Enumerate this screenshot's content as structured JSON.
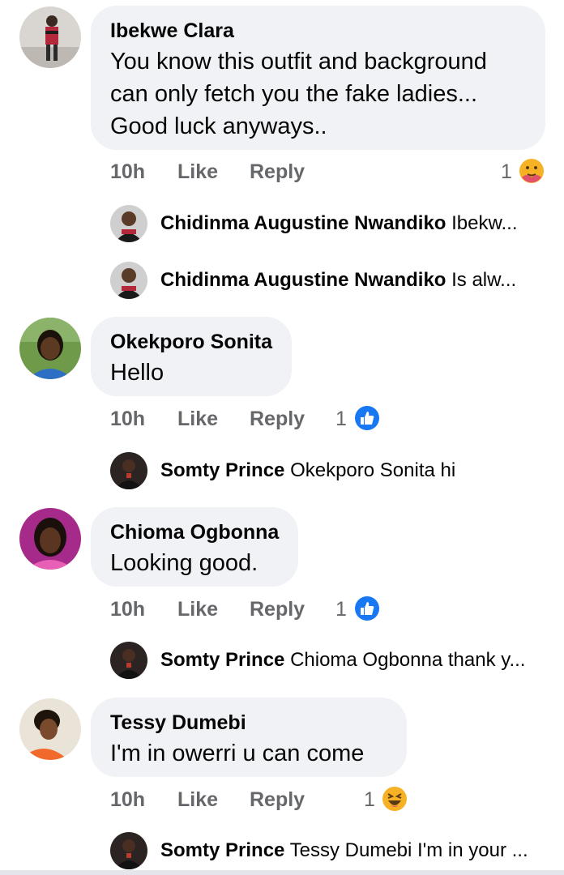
{
  "comments": [
    {
      "author": "Ibekwe Clara",
      "lines": [
        "You know this outfit and background",
        "can only fetch you the fake ladies...",
        "Good luck anyways.."
      ],
      "time": "10h",
      "like": "Like",
      "reply": "Reply",
      "reaction_count": "1",
      "reaction_icon": "care-emoji-icon",
      "replies": [
        {
          "author": "Chidinma Augustine Nwandiko",
          "preview": "Ibekw..."
        },
        {
          "author": "Chidinma Augustine Nwandiko",
          "preview": "Is alw..."
        }
      ]
    },
    {
      "author": "Okekporo Sonita",
      "lines": [
        "Hello"
      ],
      "time": "10h",
      "like": "Like",
      "reply": "Reply",
      "reaction_count": "1",
      "reaction_icon": "like-icon",
      "replies": [
        {
          "author": "Somty Prince",
          "preview": "Okekporo Sonita  hi"
        }
      ]
    },
    {
      "author": "Chioma Ogbonna",
      "lines": [
        "Looking good."
      ],
      "time": "10h",
      "like": "Like",
      "reply": "Reply",
      "reaction_count": "1",
      "reaction_icon": "like-icon",
      "replies": [
        {
          "author": "Somty Prince",
          "preview": "Chioma Ogbonna thank y..."
        }
      ]
    },
    {
      "author": "Tessy Dumebi",
      "lines": [
        "I'm in owerri u can come"
      ],
      "time": "10h",
      "like": "Like",
      "reply": "Reply",
      "reaction_count": "1",
      "reaction_icon": "haha-emoji-icon",
      "replies": [
        {
          "author": "Somty Prince",
          "preview": "Tessy Dumebi I'm in your ..."
        }
      ]
    }
  ],
  "colors": {
    "bubble": "#f0f2f5",
    "meta_text": "#65676b",
    "like_blue": "#1877f2",
    "emoji_yellow": "#f7b125"
  }
}
